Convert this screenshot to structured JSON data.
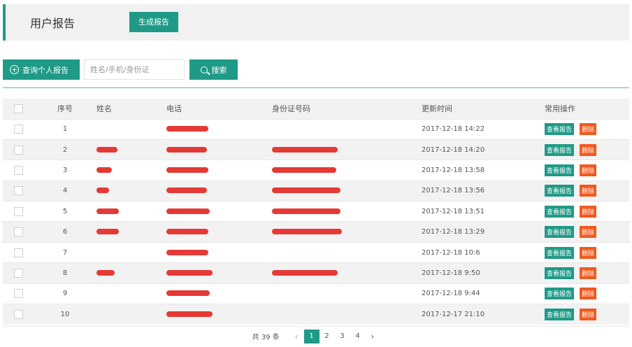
{
  "header": {
    "title": "用户报告",
    "generate_label": "生成报告"
  },
  "toolbar": {
    "query_label": "查询个人报告",
    "search_placeholder": "姓名/手机/身份证",
    "search_label": "搜索"
  },
  "table": {
    "columns": [
      "序号",
      "姓名",
      "电话",
      "身份证号码",
      "更新时间",
      "常用操作"
    ],
    "view_label": "查看报告",
    "delete_label": "删除",
    "rows": [
      {
        "idx": "1",
        "time": "2017-12-18 14:22"
      },
      {
        "idx": "2",
        "time": "2017-12-18 14:20"
      },
      {
        "idx": "3",
        "time": "2017-12-18 13:58"
      },
      {
        "idx": "4",
        "time": "2017-12-18 13:56"
      },
      {
        "idx": "5",
        "time": "2017-12-18 13:51"
      },
      {
        "idx": "6",
        "time": "2017-12-18 13:29"
      },
      {
        "idx": "7",
        "time": "2017-12-18 10:6"
      },
      {
        "idx": "8",
        "time": "2017-12-18 9:50"
      },
      {
        "idx": "9",
        "time": "2017-12-18 9:44"
      },
      {
        "idx": "10",
        "time": "2017-12-17 21:10"
      }
    ]
  },
  "pagination": {
    "total": "共 39 条",
    "pages": [
      "1",
      "2",
      "3",
      "4"
    ],
    "current": "1"
  },
  "colors": {
    "accent": "#1f9a86",
    "danger": "#f05a1e",
    "redaction": "#e53935"
  }
}
